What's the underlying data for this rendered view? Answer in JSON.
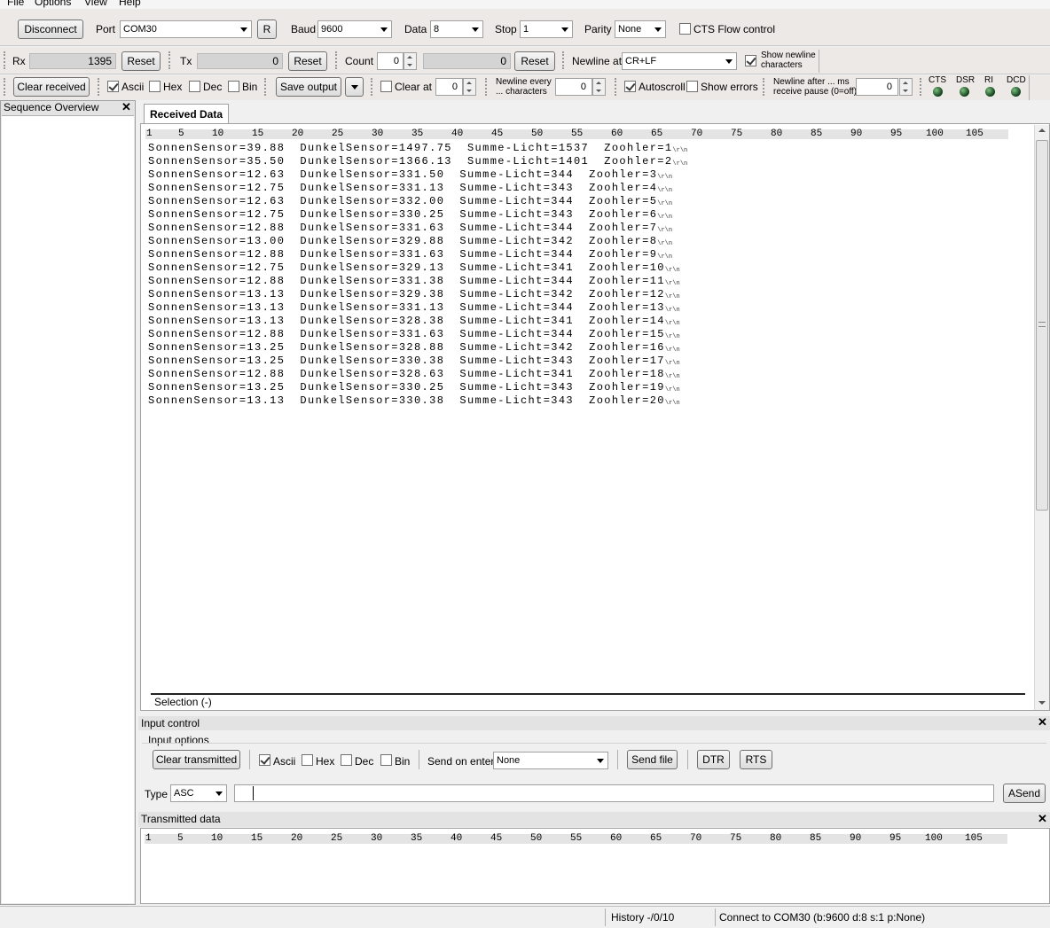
{
  "menu": [
    "File",
    "Options",
    "View",
    "Help"
  ],
  "toolbar1": {
    "disconnect": "Disconnect",
    "port_label": "Port",
    "port_value": "COM30",
    "refresh": "R",
    "baud_label": "Baud",
    "baud_value": "9600",
    "data_label": "Data",
    "data_value": "8",
    "stop_label": "Stop",
    "stop_value": "1",
    "parity_label": "Parity",
    "parity_value": "None",
    "cts_flow": "CTS Flow control"
  },
  "toolbar2": {
    "rx_label": "Rx",
    "rx_value": "1395",
    "reset": "Reset",
    "tx_label": "Tx",
    "tx_value": "0",
    "count_label": "Count",
    "count_value": "0",
    "count_field": "0",
    "newline_at_label": "Newline at",
    "newline_at_value": "CR+LF",
    "show_newline_1": "Show newline",
    "show_newline_2": "characters"
  },
  "toolbar3": {
    "clear_received": "Clear received",
    "ascii": "Ascii",
    "hex": "Hex",
    "dec": "Dec",
    "bin": "Bin",
    "save_output": "Save output",
    "clear_at": "Clear at",
    "clear_at_value": "0",
    "newline_every_1": "Newline every",
    "newline_every_2": "... characters",
    "newline_every_value": "0",
    "autoscroll": "Autoscroll",
    "show_errors": "Show errors",
    "newline_after_1": "Newline after ... ms",
    "newline_after_2": "receive pause (0=off)",
    "newline_after_value": "0",
    "signals": [
      "CTS",
      "DSR",
      "RI",
      "DCD"
    ]
  },
  "sidebar": {
    "title": "Sequence Overview"
  },
  "received": {
    "tab": "Received Data",
    "ruler": [
      "1",
      "5",
      "10",
      "15",
      "20",
      "25",
      "30",
      "35",
      "40",
      "45",
      "50",
      "55",
      "60",
      "65",
      "70",
      "75",
      "80",
      "85",
      "90",
      "95",
      "100",
      "105"
    ],
    "lines": [
      "SonnenSensor=39.88  DunkelSensor=1497.75  Summe-Licht=1537  Zoohler=1",
      "SonnenSensor=35.50  DunkelSensor=1366.13  Summe-Licht=1401  Zoohler=2",
      "SonnenSensor=12.63  DunkelSensor=331.50  Summe-Licht=344  Zoohler=3",
      "SonnenSensor=12.75  DunkelSensor=331.13  Summe-Licht=343  Zoohler=4",
      "SonnenSensor=12.63  DunkelSensor=332.00  Summe-Licht=344  Zoohler=5",
      "SonnenSensor=12.75  DunkelSensor=330.25  Summe-Licht=343  Zoohler=6",
      "SonnenSensor=12.88  DunkelSensor=331.63  Summe-Licht=344  Zoohler=7",
      "SonnenSensor=13.00  DunkelSensor=329.88  Summe-Licht=342  Zoohler=8",
      "SonnenSensor=12.88  DunkelSensor=331.63  Summe-Licht=344  Zoohler=9",
      "SonnenSensor=12.75  DunkelSensor=329.13  Summe-Licht=341  Zoohler=10",
      "SonnenSensor=12.88  DunkelSensor=331.38  Summe-Licht=344  Zoohler=11",
      "SonnenSensor=13.13  DunkelSensor=329.38  Summe-Licht=342  Zoohler=12",
      "SonnenSensor=13.13  DunkelSensor=331.13  Summe-Licht=344  Zoohler=13",
      "SonnenSensor=13.13  DunkelSensor=328.38  Summe-Licht=341  Zoohler=14",
      "SonnenSensor=12.88  DunkelSensor=331.63  Summe-Licht=344  Zoohler=15",
      "SonnenSensor=13.25  DunkelSensor=328.88  Summe-Licht=342  Zoohler=16",
      "SonnenSensor=13.25  DunkelSensor=330.38  Summe-Licht=343  Zoohler=17",
      "SonnenSensor=12.88  DunkelSensor=328.63  Summe-Licht=341  Zoohler=18",
      "SonnenSensor=13.25  DunkelSensor=330.25  Summe-Licht=343  Zoohler=19",
      "SonnenSensor=13.13  DunkelSensor=330.38  Summe-Licht=343  Zoohler=20"
    ],
    "line_end": "\\r\\n",
    "selection": "Selection (-)"
  },
  "input_control": {
    "title": "Input control",
    "options_title": "Input options",
    "clear_transmitted": "Clear transmitted",
    "ascii": "Ascii",
    "hex": "Hex",
    "dec": "Dec",
    "bin": "Bin",
    "send_on_enter_label": "Send on enter",
    "send_on_enter_value": "None",
    "send_file": "Send file",
    "dtr": "DTR",
    "rts": "RTS",
    "type_label": "Type",
    "type_value": "ASC",
    "input_value": "",
    "asend": "ASend"
  },
  "transmitted": {
    "title": "Transmitted data"
  },
  "status": {
    "history": "History -/0/10",
    "connection": "Connect to COM30 (b:9600 d:8 s:1 p:None)"
  }
}
